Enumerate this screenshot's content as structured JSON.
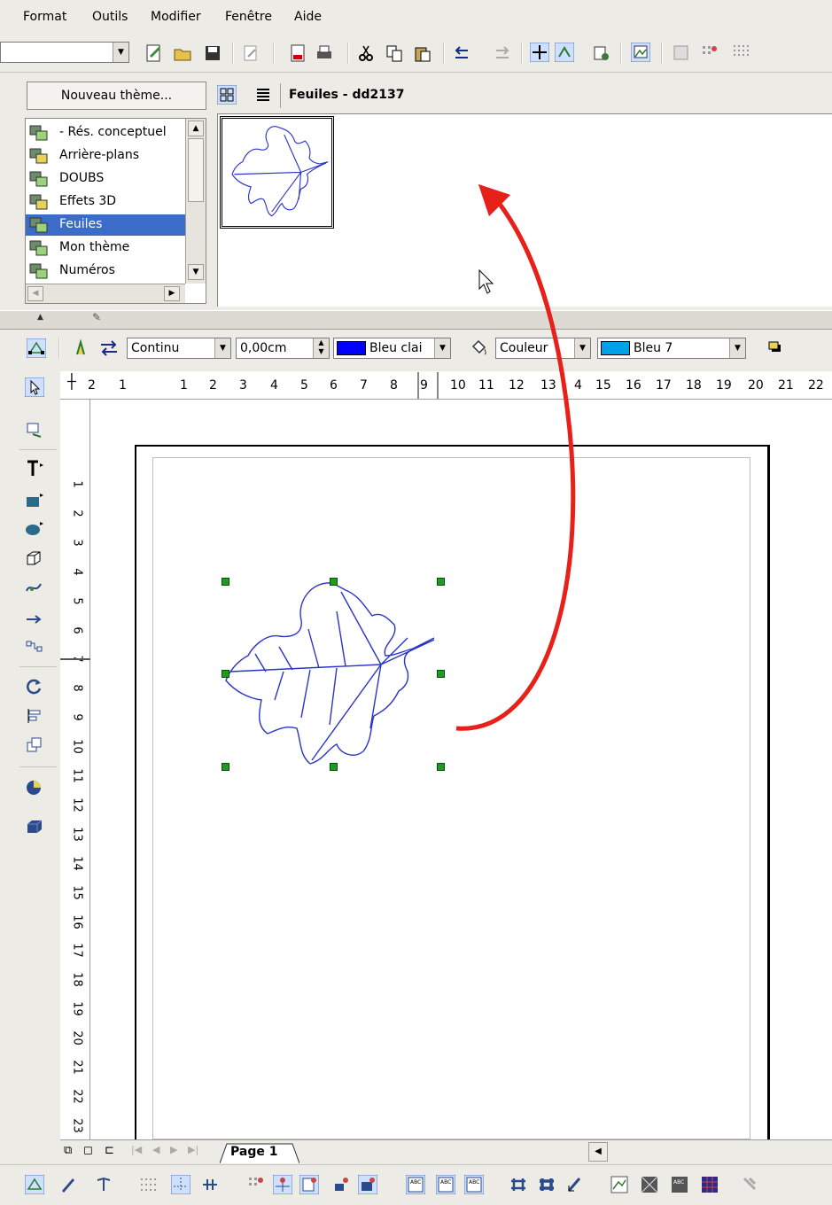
{
  "menubar": {
    "items": [
      {
        "label": "Format"
      },
      {
        "label": "Outils"
      },
      {
        "label": "Modifier"
      },
      {
        "label": "Fenêtre"
      },
      {
        "label": "Aide"
      }
    ]
  },
  "gallery": {
    "new_theme_button": "Nouveau thème...",
    "title": "Feuiles - dd2137",
    "themes": [
      {
        "label": "- Rés. conceptuel"
      },
      {
        "label": "Arrière-plans"
      },
      {
        "label": "DOUBS"
      },
      {
        "label": "Effets 3D"
      },
      {
        "label": "Feuiles",
        "selected": true
      },
      {
        "label": "Mon thème"
      },
      {
        "label": "Numéros"
      }
    ]
  },
  "line_toolbar": {
    "line_style": "Continu",
    "line_width": "0,00cm",
    "line_color": "Bleu clai",
    "line_color_hex": "#0000ff",
    "fill_type": "Couleur",
    "fill_color": "Bleu 7",
    "fill_color_hex": "#00a0e8"
  },
  "ruler": {
    "h_numbers": [
      "2",
      "1",
      "1",
      "2",
      "3",
      "4",
      "5",
      "6",
      "7",
      "8",
      "9",
      "10",
      "11",
      "12",
      "13",
      "4",
      "15",
      "16",
      "17",
      "18",
      "19",
      "20",
      "21",
      "22"
    ],
    "v_numbers": [
      "1",
      "2",
      "3",
      "4",
      "5",
      "6",
      "7",
      "8",
      "9",
      "10",
      "11",
      "12",
      "13",
      "14",
      "15",
      "16",
      "17",
      "18",
      "19",
      "20",
      "21",
      "22",
      "23"
    ]
  },
  "tabs": {
    "page_tab": "Page 1"
  },
  "colors": {
    "annotation_arrow": "#e8201a",
    "leaf_stroke": "#2a35c8",
    "selection_handle": "#1f9b1f",
    "selected_item_bg": "#3b6cc8"
  }
}
